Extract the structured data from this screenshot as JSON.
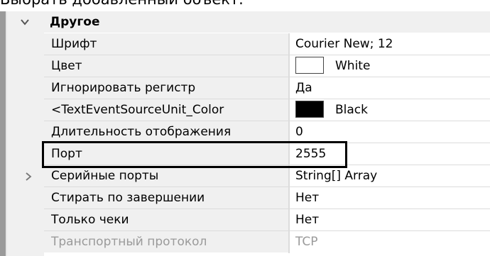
{
  "top_text": "Выбрать добавленный объект.",
  "category": {
    "label": "Другое"
  },
  "rows": [
    {
      "name": "Шрифт",
      "value": "Courier New; 12"
    },
    {
      "name": "Цвет",
      "value": "White",
      "swatch": "#ffffff"
    },
    {
      "name": "Игнорировать регистр",
      "value": "Да"
    },
    {
      "name": "<TextEventSourceUnit_Color",
      "value": "Black",
      "swatch": "#000000"
    },
    {
      "name": "Длительность отображения",
      "value": "0"
    },
    {
      "name": "Порт",
      "value": "2555"
    },
    {
      "name": "Серийные порты",
      "value": "String[] Array"
    },
    {
      "name": "Стирать по завершении",
      "value": "Нет"
    },
    {
      "name": "Только чеки",
      "value": "Нет"
    },
    {
      "name": "Транспортный протокол",
      "value": "TCP"
    }
  ],
  "colors": {
    "gutter": "#f0f0f0",
    "border": "#9a9a9a",
    "disabled_text": "#9a9a9a",
    "highlight": "#000000"
  }
}
